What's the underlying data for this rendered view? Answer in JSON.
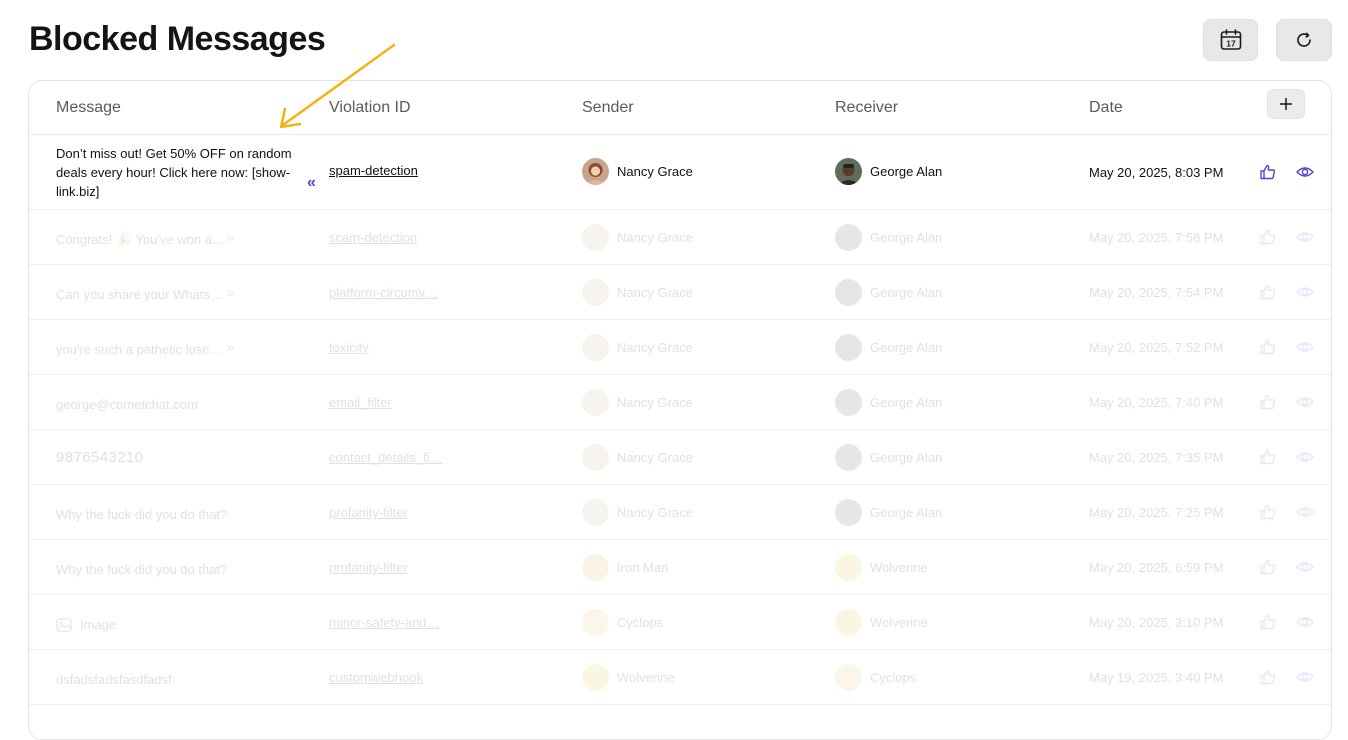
{
  "page": {
    "title": "Blocked Messages",
    "icons": {
      "calendar": "calendar-icon",
      "refresh": "refresh-icon",
      "add": "plus-icon",
      "annotation": "arrow-annotation"
    }
  },
  "calendar": {
    "day": "17"
  },
  "colors": {
    "accent": "#5b3fd3",
    "annotation_arrow": "#f5b313",
    "button_bg": "#e8e8e8"
  },
  "table": {
    "columns": [
      "Message",
      "Violation ID",
      "Sender",
      "Receiver",
      "Date"
    ],
    "rows": [
      {
        "message": "Don’t miss out! Get 50% OFF on random deals every hour! Click here now: [show-link.biz]",
        "violation": "spam-detection",
        "sender": "Nancy Grace",
        "receiver": "George Alan",
        "date": "May 20, 2025, 8:03 PM"
      },
      {
        "message": "Congrats! 🎉 You've won a…",
        "violation": "scam-detection",
        "sender": "Nancy Grace",
        "receiver": "George Alan",
        "date": "May 20, 2025, 7:58 PM"
      },
      {
        "message": "Can you share your Whats…",
        "violation": "platform-circumv…",
        "sender": "Nancy Grace",
        "receiver": "George Alan",
        "date": "May 20, 2025, 7:54 PM"
      },
      {
        "message": "you're such a pathetic lose…",
        "violation": "toxicity",
        "sender": "Nancy Grace",
        "receiver": "George Alan",
        "date": "May 20, 2025, 7:52 PM"
      },
      {
        "message": "george@cometchat.com",
        "violation": "email_filter",
        "sender": "Nancy Grace",
        "receiver": "George Alan",
        "date": "May 20, 2025, 7:40 PM"
      },
      {
        "message": "9876543210",
        "violation": "contact_details_fi…",
        "sender": "Nancy Grace",
        "receiver": "George Alan",
        "date": "May 20, 2025, 7:35 PM"
      },
      {
        "message": "Why the fuck did you do that?",
        "violation": "profanity-filter",
        "sender": "Nancy Grace",
        "receiver": "George Alan",
        "date": "May 20, 2025, 7:25 PM"
      },
      {
        "message": "Why the fuck did you do that?",
        "violation": "profanity-filter",
        "sender": "Iron Man",
        "receiver": "Wolverine",
        "date": "May 20, 2025, 6:59 PM"
      },
      {
        "message": "Image",
        "violation": "minor-safety-and…",
        "sender": "Cyclops",
        "receiver": "Wolverine",
        "date": "May 20, 2025, 3:10 PM"
      },
      {
        "message": "dsfadsfadsfasdfadsf",
        "violation": "customwebhook",
        "sender": "Wolverine",
        "receiver": "Cyclops",
        "date": "May 19, 2025, 3:40 PM"
      }
    ]
  }
}
